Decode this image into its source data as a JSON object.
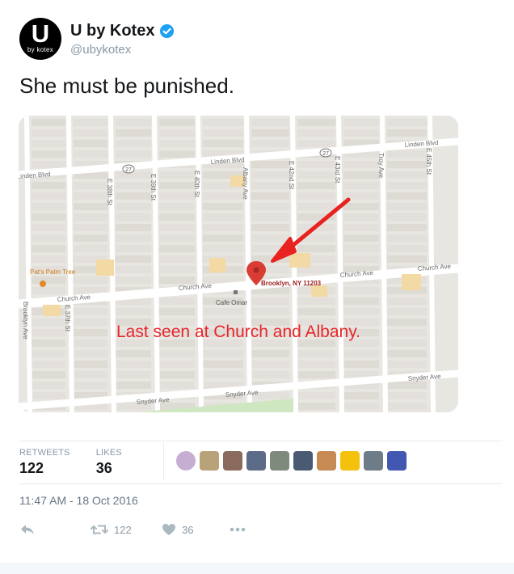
{
  "tweet": {
    "display_name": "U by Kotex",
    "handle": "@ubykotex",
    "avatar_letter": "U",
    "avatar_sub": "by kotex",
    "text": "She must be punished.",
    "timestamp": "11:47 AM - 18 Oct 2016"
  },
  "map": {
    "pin_label": "Brooklyn, NY 11203",
    "caption": "Last seen at Church and Albany.",
    "place_1": "Pat's Palm Tree",
    "place_2": "Cafe Omar",
    "streets_horizontal": [
      "Linden Blvd",
      "Linden Blvd",
      "Linden Blvd",
      "Church Ave",
      "Church Ave",
      "Church Ave",
      "Church Ave",
      "Snyder Ave",
      "Snyder Ave",
      "Snyder Ave"
    ],
    "streets_vertical": [
      "Brooklyn Ave",
      "E 37th St",
      "E 38th St",
      "E 39th St",
      "E 40th St",
      "Albany Ave",
      "E 42nd St",
      "E 43rd St",
      "Troy Ave",
      "E 45th St"
    ],
    "route_shield": "27",
    "colors": {
      "caption": "#e6262a",
      "pin": "#d93c32",
      "arrow": "#e8221f",
      "park": "#cfe7c0"
    }
  },
  "stats": {
    "retweets_label": "RETWEETS",
    "retweets_value": "122",
    "likes_label": "LIKES",
    "likes_value": "36",
    "liker_colors": [
      "#c6aed3",
      "#b8a27a",
      "#8a6a5c",
      "#5c6b88",
      "#7e8a7c",
      "#4a5a73",
      "#c78a52",
      "#f4c20d",
      "#6e7c87",
      "#4257b2"
    ]
  },
  "actions": {
    "reply_icon": "reply-icon",
    "retweet_count": "122",
    "like_count": "36",
    "more_icon": "more-icon"
  }
}
